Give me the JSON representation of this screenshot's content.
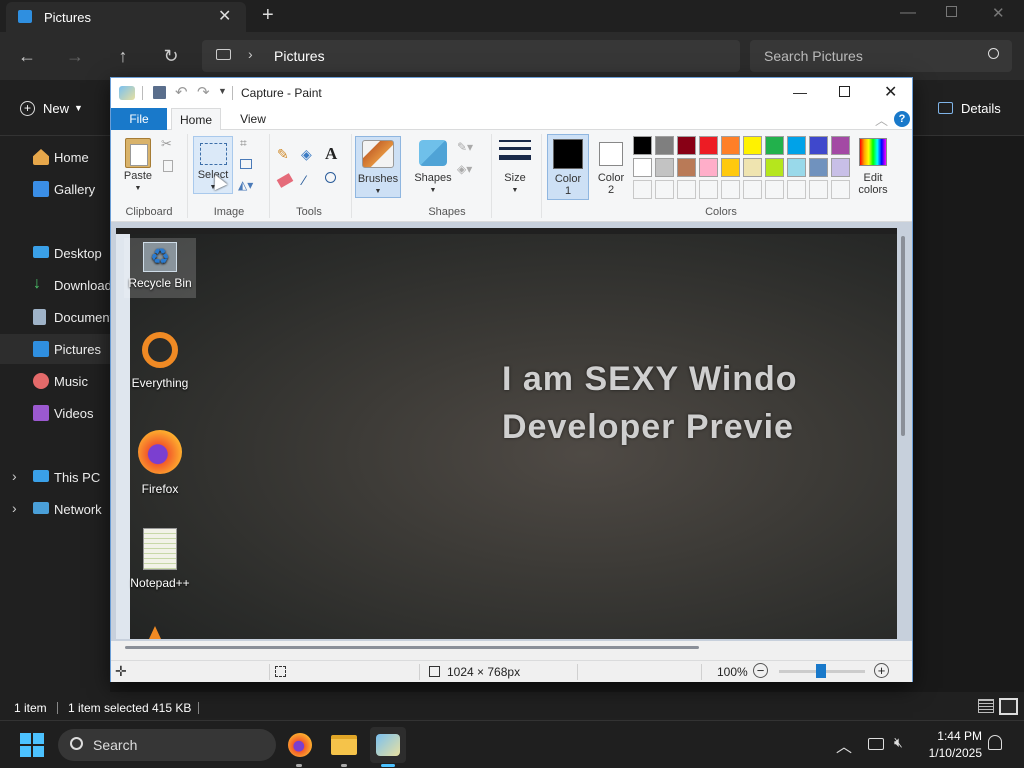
{
  "explorer": {
    "tab_title": "Pictures",
    "breadcrumb": "Pictures",
    "search_placeholder": "Search Pictures",
    "new_label": "New",
    "details_label": "Details",
    "sidebar": {
      "items": [
        {
          "label": "Home",
          "icon": "home-icon"
        },
        {
          "label": "Gallery",
          "icon": "gallery-icon"
        },
        {
          "label": "Desktop",
          "icon": "desktop-icon"
        },
        {
          "label": "Download",
          "icon": "download-icon"
        },
        {
          "label": "Document",
          "icon": "document-icon"
        },
        {
          "label": "Pictures",
          "icon": "pictures-icon"
        },
        {
          "label": "Music",
          "icon": "music-icon"
        },
        {
          "label": "Videos",
          "icon": "videos-icon"
        },
        {
          "label": "This PC",
          "icon": "pc-icon"
        },
        {
          "label": "Network",
          "icon": "network-icon"
        }
      ]
    },
    "status": {
      "count": "1 item",
      "selected": "1 item selected",
      "size": "415 KB"
    }
  },
  "paint": {
    "title": "Capture - Paint",
    "tabs": {
      "file": "File",
      "home": "Home",
      "view": "View"
    },
    "ribbon": {
      "paste": "Paste",
      "select": "Select",
      "brushes": "Brushes",
      "shapes": "Shapes",
      "size": "Size",
      "color1": "Color\n1",
      "color1_a": "Color",
      "color1_b": "1",
      "color2_a": "Color",
      "color2_b": "2",
      "edit_colors_a": "Edit",
      "edit_colors_b": "colors",
      "groups": {
        "clipboard": "Clipboard",
        "image": "Image",
        "tools": "Tools",
        "shapes": "Shapes",
        "colors": "Colors"
      }
    },
    "palette_row1": [
      "#000000",
      "#7f7f7f",
      "#880015",
      "#ed1c24",
      "#ff7f27",
      "#fff200",
      "#22b14c",
      "#00a2e8",
      "#3f48cc",
      "#a349a4"
    ],
    "palette_row2": [
      "#ffffff",
      "#c3c3c3",
      "#b97a57",
      "#ffaec9",
      "#ffc90e",
      "#efe4b0",
      "#b5e61d",
      "#99d9ea",
      "#7092be",
      "#c8bfe7"
    ],
    "canvas": {
      "desktop_icons": [
        {
          "label": "Recycle Bin",
          "icon": "recycle-bin-icon"
        },
        {
          "label": "Everything",
          "icon": "everything-icon"
        },
        {
          "label": "Firefox",
          "icon": "firefox-icon"
        },
        {
          "label": "Notepad++",
          "icon": "notepadpp-icon"
        }
      ],
      "text_line1": "I am SEXY Windo",
      "text_line2": "Developer Previe"
    },
    "status": {
      "dimensions": "1024 × 768px",
      "zoom": "100%"
    }
  },
  "taskbar": {
    "search_label": "Search",
    "time": "1:44 PM",
    "date": "1/10/2025"
  }
}
